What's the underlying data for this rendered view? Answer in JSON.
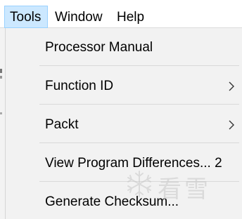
{
  "menubar": {
    "items": [
      {
        "label": "Tools",
        "active": true
      },
      {
        "label": "Window",
        "active": false
      },
      {
        "label": "Help",
        "active": false
      }
    ]
  },
  "dropdown": {
    "items": [
      {
        "label": "Processor Manual",
        "submenu": false
      },
      {
        "label": "Function ID",
        "submenu": true
      },
      {
        "label": "Packt",
        "submenu": true
      },
      {
        "label": "View Program Differences... 2",
        "submenu": false
      },
      {
        "label": "Generate Checksum...",
        "submenu": false
      }
    ]
  },
  "watermark": {
    "text": "看雪",
    "icon": "snowflake-logo"
  },
  "colors": {
    "menubar_bg": "#ffffff",
    "active_bg": "#cce8ff",
    "active_border": "#99d1ff",
    "dropdown_bg": "#f2f2f2",
    "separator": "#d9d9d9"
  }
}
